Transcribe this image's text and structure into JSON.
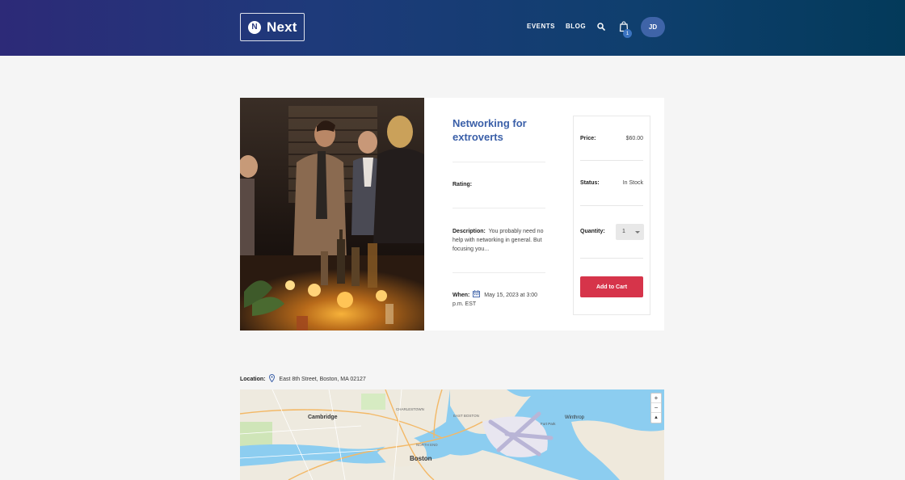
{
  "header": {
    "logo_text": "Next",
    "logo_mark": "N",
    "nav": {
      "events": "EVENTS",
      "blog": "BLOG"
    },
    "cart_count": "1",
    "avatar_initials": "JD",
    "icons": {
      "search": "search-icon",
      "cart": "shopping-bag-icon"
    }
  },
  "event": {
    "title": "Networking for extroverts",
    "rating_label": "Rating:",
    "description_label": "Description:",
    "description": "You probably need no help with networking in general. But focusing you...",
    "when_label": "When:",
    "when": "May 15, 2023 at 3:00 p.m. EST",
    "image_alt": "people networking at an evening event"
  },
  "buybox": {
    "price_label": "Price:",
    "price": "$60.00",
    "status_label": "Status:",
    "status": "In Stock",
    "quantity_label": "Quantity:",
    "quantity": "1",
    "add_to_cart": "Add to Cart"
  },
  "location": {
    "label": "Location:",
    "address": "East 8th Street, Boston, MA 02127"
  },
  "map": {
    "labels": {
      "cambridge": "Cambridge",
      "boston": "Boston",
      "winthrop": "Winthrop",
      "charlestown": "CHARLESTOWN",
      "east_boston": "EAST BOSTON",
      "fort_park": "Fort Park",
      "north_end": "NORTH END"
    },
    "zoom_in": "+",
    "zoom_out": "−",
    "reset": "▲"
  },
  "colors": {
    "accent_title": "#3a5fa8",
    "cta": "#d6344a",
    "header_start": "#2d2a78",
    "header_end": "#033a5a"
  }
}
